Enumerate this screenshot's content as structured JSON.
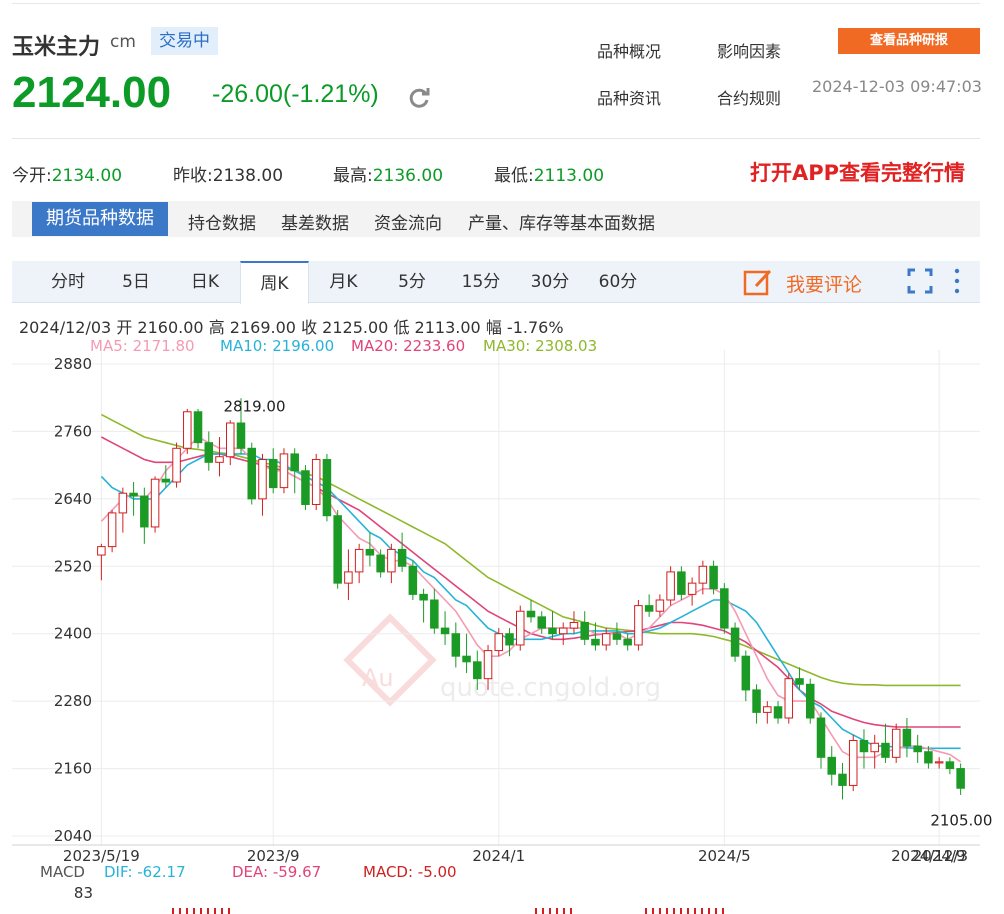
{
  "header": {
    "title": "玉米主力",
    "unit": "cm",
    "status": "交易中",
    "price": "2124.00",
    "change": "-26.00(-1.21%)",
    "links": [
      "品种概况",
      "影响因素",
      "品种资讯",
      "合约规则"
    ],
    "research_button": "查看品种研报",
    "timestamp": "2024-12-03 09:47:03"
  },
  "stats": {
    "open_label": "今开:",
    "open": "2134.00",
    "prev_label": "昨收:",
    "prev": "2138.00",
    "high_label": "最高:",
    "high": "2136.00",
    "low_label": "最低:",
    "low": "2113.00",
    "app_link": "打开APP查看完整行情"
  },
  "subnav": [
    "期货品种数据",
    "持仓数据",
    "基差数据",
    "资金流向",
    "产量、库存等基本面数据"
  ],
  "tabs": [
    "分时",
    "5日",
    "日K",
    "周K",
    "月K",
    "5分",
    "15分",
    "30分",
    "60分"
  ],
  "active_tab": "周K",
  "comment_label": "我要评论",
  "info_bar": {
    "date": "2024/12/03",
    "open_label": "开",
    "open": "2160.00",
    "high_label": "高",
    "high": "2169.00",
    "close_label": "收",
    "close": "2125.00",
    "low_label": "低",
    "low": "2113.00",
    "range_label": "幅",
    "range": "-1.76%"
  },
  "ma_legend": [
    {
      "text": "MA5: 2171.80",
      "color": "#f49ab4"
    },
    {
      "text": "MA10: 2196.00",
      "color": "#27b3d8"
    },
    {
      "text": "MA20: 2233.60",
      "color": "#e0457a"
    },
    {
      "text": "MA30: 2308.03",
      "color": "#8fb82a"
    }
  ],
  "macd_legend": [
    {
      "text": "MACD",
      "color": "#555555"
    },
    {
      "text": "DIF: -62.17",
      "color": "#27b3d8"
    },
    {
      "text": "DEA: -59.67",
      "color": "#e0457a"
    },
    {
      "text": "MACD: -5.00",
      "color": "#d02020"
    }
  ],
  "macd_axis_label": "83",
  "colors": {
    "up": "#d21f1f",
    "down": "#1b9b25",
    "accent": "#3b78c8",
    "orange": "#f06a24"
  },
  "chart_data": {
    "type": "candlestick",
    "title": "",
    "ylim": [
      2040,
      2880
    ],
    "y_ticks": [
      2880,
      2760,
      2640,
      2520,
      2400,
      2280,
      2160,
      2040
    ],
    "x_tick_labels": [
      "2023/5/19",
      "2023/9",
      "2024/1",
      "2024/5",
      "2024/9",
      "2024/12/3"
    ],
    "x_tick_positions": [
      0,
      16,
      37,
      58,
      78,
      86
    ],
    "annotations": [
      {
        "text": "2819.00",
        "index": 15,
        "value": 2819
      },
      {
        "text": "2105.00",
        "index": 81,
        "value": 2105
      }
    ],
    "candles": [
      [
        2540,
        2560,
        2495,
        2555
      ],
      [
        2555,
        2620,
        2545,
        2615
      ],
      [
        2615,
        2660,
        2580,
        2650
      ],
      [
        2650,
        2670,
        2610,
        2645
      ],
      [
        2645,
        2660,
        2560,
        2590
      ],
      [
        2590,
        2680,
        2580,
        2675
      ],
      [
        2675,
        2700,
        2660,
        2670
      ],
      [
        2670,
        2740,
        2660,
        2730
      ],
      [
        2730,
        2800,
        2720,
        2795
      ],
      [
        2795,
        2800,
        2730,
        2740
      ],
      [
        2740,
        2760,
        2690,
        2705
      ],
      [
        2705,
        2750,
        2680,
        2715
      ],
      [
        2715,
        2780,
        2700,
        2775
      ],
      [
        2775,
        2819,
        2720,
        2730
      ],
      [
        2730,
        2740,
        2630,
        2640
      ],
      [
        2640,
        2720,
        2610,
        2710
      ],
      [
        2710,
        2730,
        2650,
        2660
      ],
      [
        2660,
        2730,
        2650,
        2720
      ],
      [
        2720,
        2730,
        2650,
        2690
      ],
      [
        2690,
        2700,
        2620,
        2630
      ],
      [
        2630,
        2720,
        2620,
        2710
      ],
      [
        2710,
        2720,
        2600,
        2610
      ],
      [
        2610,
        2620,
        2480,
        2490
      ],
      [
        2490,
        2550,
        2460,
        2510
      ],
      [
        2510,
        2560,
        2490,
        2550
      ],
      [
        2550,
        2580,
        2520,
        2540
      ],
      [
        2540,
        2550,
        2500,
        2510
      ],
      [
        2510,
        2560,
        2490,
        2550
      ],
      [
        2550,
        2580,
        2510,
        2520
      ],
      [
        2520,
        2530,
        2460,
        2470
      ],
      [
        2470,
        2480,
        2420,
        2460
      ],
      [
        2460,
        2480,
        2400,
        2410
      ],
      [
        2410,
        2440,
        2380,
        2400
      ],
      [
        2400,
        2420,
        2340,
        2360
      ],
      [
        2360,
        2400,
        2330,
        2350
      ],
      [
        2350,
        2370,
        2300,
        2320
      ],
      [
        2320,
        2380,
        2300,
        2370
      ],
      [
        2370,
        2410,
        2360,
        2400
      ],
      [
        2400,
        2410,
        2360,
        2380
      ],
      [
        2380,
        2450,
        2370,
        2440
      ],
      [
        2440,
        2460,
        2420,
        2430
      ],
      [
        2430,
        2440,
        2400,
        2410
      ],
      [
        2410,
        2440,
        2390,
        2400
      ],
      [
        2400,
        2420,
        2380,
        2410
      ],
      [
        2410,
        2440,
        2400,
        2420
      ],
      [
        2420,
        2440,
        2380,
        2390
      ],
      [
        2390,
        2420,
        2370,
        2380
      ],
      [
        2380,
        2410,
        2370,
        2400
      ],
      [
        2400,
        2420,
        2380,
        2390
      ],
      [
        2390,
        2400,
        2370,
        2380
      ],
      [
        2380,
        2460,
        2370,
        2450
      ],
      [
        2450,
        2470,
        2430,
        2440
      ],
      [
        2440,
        2470,
        2430,
        2460
      ],
      [
        2460,
        2520,
        2450,
        2510
      ],
      [
        2510,
        2520,
        2460,
        2470
      ],
      [
        2470,
        2500,
        2450,
        2490
      ],
      [
        2490,
        2530,
        2470,
        2520
      ],
      [
        2520,
        2530,
        2470,
        2480
      ],
      [
        2480,
        2490,
        2400,
        2410
      ],
      [
        2410,
        2420,
        2350,
        2360
      ],
      [
        2360,
        2370,
        2280,
        2300
      ],
      [
        2300,
        2310,
        2240,
        2260
      ],
      [
        2260,
        2280,
        2240,
        2270
      ],
      [
        2270,
        2280,
        2240,
        2250
      ],
      [
        2250,
        2330,
        2240,
        2320
      ],
      [
        2320,
        2340,
        2300,
        2310
      ],
      [
        2310,
        2320,
        2240,
        2250
      ],
      [
        2250,
        2260,
        2160,
        2180
      ],
      [
        2180,
        2200,
        2130,
        2150
      ],
      [
        2150,
        2170,
        2105,
        2130
      ],
      [
        2130,
        2220,
        2120,
        2210
      ],
      [
        2210,
        2230,
        2160,
        2190
      ],
      [
        2190,
        2220,
        2160,
        2205
      ],
      [
        2205,
        2240,
        2170,
        2180
      ],
      [
        2180,
        2240,
        2170,
        2230
      ],
      [
        2230,
        2250,
        2180,
        2200
      ],
      [
        2200,
        2220,
        2170,
        2190
      ],
      [
        2190,
        2200,
        2160,
        2170
      ],
      [
        2170,
        2180,
        2160,
        2172
      ],
      [
        2172,
        2180,
        2150,
        2160
      ],
      [
        2160,
        2169,
        2113,
        2125
      ]
    ],
    "ma5": [
      2600,
      2620,
      2640,
      2650,
      2640,
      2660,
      2690,
      2710,
      2730,
      2750,
      2740,
      2730,
      2730,
      2730,
      2710,
      2700,
      2690,
      2690,
      2680,
      2670,
      2660,
      2640,
      2610,
      2590,
      2570,
      2560,
      2540,
      2530,
      2530,
      2520,
      2500,
      2480,
      2460,
      2440,
      2410,
      2380,
      2360,
      2360,
      2370,
      2390,
      2400,
      2410,
      2410,
      2410,
      2410,
      2410,
      2400,
      2400,
      2400,
      2390,
      2400,
      2410,
      2430,
      2450,
      2460,
      2470,
      2480,
      2480,
      2470,
      2440,
      2400,
      2360,
      2320,
      2290,
      2280,
      2280,
      2280,
      2250,
      2220,
      2190,
      2180,
      2180,
      2180,
      2190,
      2195,
      2200,
      2200,
      2195,
      2190,
      2185,
      2172
    ],
    "ma10": [
      2680,
      2660,
      2650,
      2640,
      2640,
      2640,
      2660,
      2680,
      2700,
      2710,
      2720,
      2720,
      2720,
      2720,
      2720,
      2710,
      2710,
      2700,
      2690,
      2680,
      2670,
      2660,
      2640,
      2620,
      2600,
      2580,
      2570,
      2550,
      2540,
      2530,
      2510,
      2500,
      2480,
      2460,
      2450,
      2430,
      2410,
      2400,
      2390,
      2390,
      2390,
      2390,
      2395,
      2400,
      2400,
      2405,
      2405,
      2405,
      2405,
      2400,
      2400,
      2405,
      2410,
      2420,
      2430,
      2440,
      2450,
      2460,
      2460,
      2450,
      2440,
      2420,
      2390,
      2360,
      2330,
      2300,
      2280,
      2270,
      2250,
      2230,
      2220,
      2210,
      2200,
      2200,
      2198,
      2197,
      2196,
      2196,
      2196,
      2196,
      2196
    ],
    "ma20": [
      2750,
      2740,
      2730,
      2720,
      2710,
      2705,
      2705,
      2705,
      2710,
      2715,
      2720,
      2720,
      2715,
      2710,
      2705,
      2700,
      2695,
      2690,
      2680,
      2670,
      2660,
      2650,
      2640,
      2630,
      2620,
      2605,
      2590,
      2575,
      2560,
      2545,
      2530,
      2515,
      2500,
      2485,
      2470,
      2455,
      2440,
      2430,
      2420,
      2410,
      2400,
      2395,
      2390,
      2390,
      2392,
      2395,
      2398,
      2400,
      2402,
      2404,
      2405,
      2410,
      2415,
      2420,
      2420,
      2418,
      2415,
      2410,
      2405,
      2395,
      2385,
      2370,
      2355,
      2340,
      2320,
      2300,
      2285,
      2275,
      2262,
      2255,
      2248,
      2242,
      2238,
      2236,
      2234,
      2234,
      2234,
      2234,
      2234,
      2234,
      2234
    ],
    "ma30": [
      2790,
      2780,
      2770,
      2760,
      2750,
      2745,
      2740,
      2735,
      2730,
      2728,
      2725,
      2722,
      2720,
      2715,
      2710,
      2705,
      2700,
      2695,
      2690,
      2685,
      2680,
      2670,
      2660,
      2650,
      2640,
      2630,
      2620,
      2610,
      2600,
      2590,
      2580,
      2570,
      2560,
      2545,
      2530,
      2515,
      2500,
      2490,
      2480,
      2470,
      2460,
      2450,
      2440,
      2430,
      2425,
      2420,
      2415,
      2410,
      2408,
      2406,
      2404,
      2402,
      2400,
      2400,
      2400,
      2400,
      2398,
      2395,
      2390,
      2385,
      2378,
      2370,
      2362,
      2354,
      2346,
      2338,
      2330,
      2322,
      2316,
      2312,
      2310,
      2309,
      2309,
      2308,
      2308,
      2308,
      2308,
      2308,
      2308,
      2308,
      2308
    ]
  }
}
